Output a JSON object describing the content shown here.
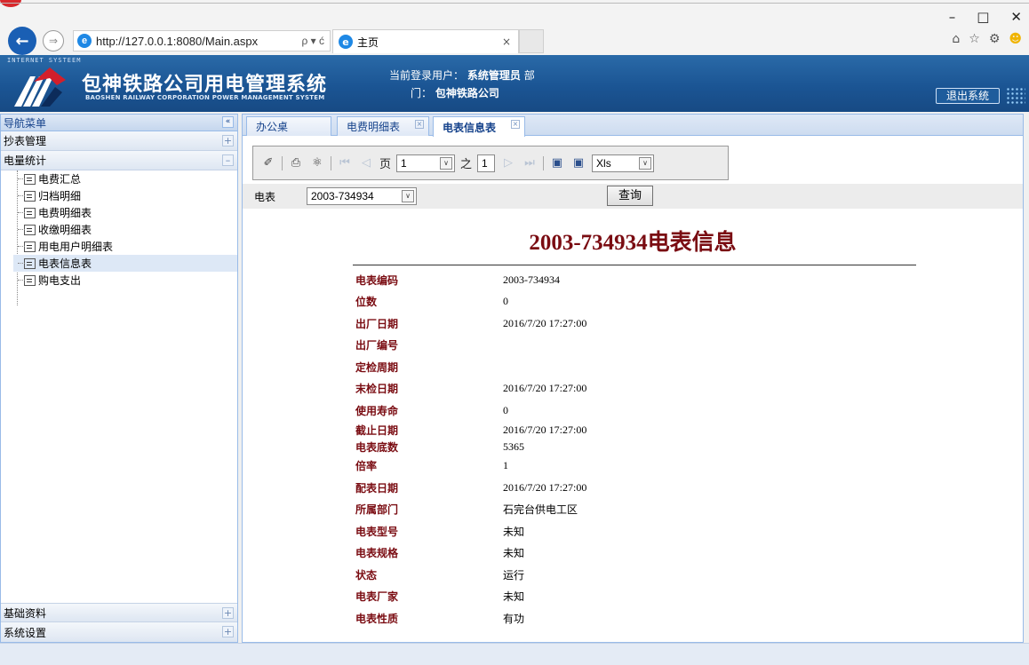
{
  "browser": {
    "url": "http://127.0.0.1:8080/Main.aspx",
    "url_tools": "ρ ▾ ć",
    "tab_title": "主页",
    "tab_close": "×",
    "win_min": "–",
    "win_max": "□",
    "win_close": "✕"
  },
  "header": {
    "tagline": "INTERNET SYSTEEM",
    "title": "包神铁路公司用电管理系统",
    "subtitle": "BAOSHEN RAILWAY CORPORATION POWER MANAGEMENT SYSTEM",
    "user_label": "当前登录用户：",
    "user_name": "系统管理员",
    "dept_prefix": "部",
    "dept_line": "门：",
    "dept_name": "包神铁路公司",
    "logout_label": "退出系统"
  },
  "nav": {
    "title": "导航菜单",
    "collapse": "«",
    "sections": [
      {
        "label": "抄表管理",
        "toggle": "+"
      },
      {
        "label": "电量统计",
        "toggle": "–"
      }
    ],
    "items": [
      {
        "label": "电费汇总"
      },
      {
        "label": "归档明细"
      },
      {
        "label": "电费明细表"
      },
      {
        "label": "收缴明细表"
      },
      {
        "label": "用电用户明细表"
      },
      {
        "label": "电表信息表"
      },
      {
        "label": "购电支出"
      }
    ],
    "bottom_sections": [
      {
        "label": "基础资料",
        "toggle": "+"
      },
      {
        "label": "系统设置",
        "toggle": "+"
      }
    ]
  },
  "tabs": [
    {
      "label": "办公桌",
      "close": ""
    },
    {
      "label": "电费明细表",
      "close": "×"
    },
    {
      "label": "电表信息表",
      "close": "×"
    }
  ],
  "toolbar": {
    "page_label": "页",
    "page_value": "1",
    "of_label": "之",
    "total_pages": "1",
    "export_format": "Xls",
    "arrow": "∨"
  },
  "query": {
    "meter_label": "电表",
    "meter_value": "2003-734934",
    "button_label": "查询"
  },
  "report": {
    "title": "2003-734934电表信息",
    "rows": [
      {
        "label": "电表编码",
        "value": "2003-734934"
      },
      {
        "label": "位数",
        "value": "0"
      },
      {
        "label": "出厂日期",
        "value": "2016/7/20 17:27:00"
      },
      {
        "label": "出厂编号",
        "value": ""
      },
      {
        "label": "定检周期",
        "value": ""
      },
      {
        "label": "末检日期",
        "value": "2016/7/20 17:27:00"
      },
      {
        "label": "使用寿命",
        "value": "0"
      },
      {
        "label": "截止日期",
        "value": "2016/7/20 17:27:00"
      },
      {
        "label": "电表底数",
        "value": "5365"
      },
      {
        "label": "倍率",
        "value": "1"
      },
      {
        "label": "配表日期",
        "value": "2016/7/20 17:27:00"
      },
      {
        "label": "所属部门",
        "value": "石完台供电工区"
      },
      {
        "label": "电表型号",
        "value": "未知"
      },
      {
        "label": "电表规格",
        "value": "未知"
      },
      {
        "label": "状态",
        "value": "运行"
      },
      {
        "label": "电表厂家",
        "value": "未知"
      },
      {
        "label": "电表性质",
        "value": "有功"
      }
    ]
  },
  "colors": {
    "header_blue": "#1b5594",
    "nav_border": "#99bbe8",
    "report_label": "#7a0c12"
  }
}
